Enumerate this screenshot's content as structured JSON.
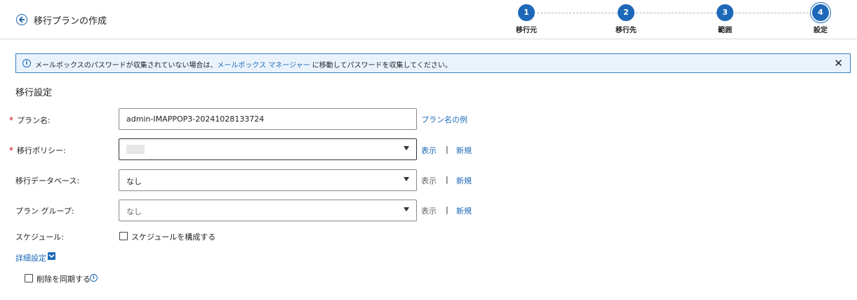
{
  "header": {
    "title": "移行プランの作成",
    "steps": [
      {
        "number": "1",
        "label": "移行元"
      },
      {
        "number": "2",
        "label": "移行先"
      },
      {
        "number": "3",
        "label": "範囲"
      },
      {
        "number": "4",
        "label": "設定"
      }
    ],
    "current_step": 4
  },
  "banner": {
    "icon": "info-icon",
    "text_before": "メールボックスのパスワードが収集されていない場合は、",
    "link_text": "メールボックス マネージャー",
    "text_after": " に移動してパスワードを収集してください。",
    "close_glyph": "✕"
  },
  "settings": {
    "section_title": "移行設定",
    "plan_name": {
      "label": "プラン名:",
      "required": "*",
      "value": "admin-IMAPPOP3-20241028133724",
      "example_link": "プラン名の例"
    },
    "migration_policy": {
      "label": "移行ポリシー:",
      "required": "*",
      "show_link": "表示",
      "separator": "|",
      "new_link": "新規"
    },
    "migration_database": {
      "label": "移行データベース:",
      "value": "なし",
      "show_link": "表示",
      "separator": "|",
      "new_link": "新規"
    },
    "plan_group": {
      "label": "プラン グループ:",
      "value": "なし",
      "show_link": "表示",
      "separator": "|",
      "new_link": "新規"
    },
    "schedule": {
      "label": "スケジュール:",
      "checkbox_label": "スケジュールを構成する",
      "checked": false
    },
    "advanced": {
      "label": "詳細設定",
      "expanded": true,
      "sync_delete_label": "削除を同期する",
      "sync_delete_checked": false
    }
  },
  "colors": {
    "accent": "#1d68b8",
    "required": "#d0021b",
    "banner_bg": "#eaf3fc"
  }
}
